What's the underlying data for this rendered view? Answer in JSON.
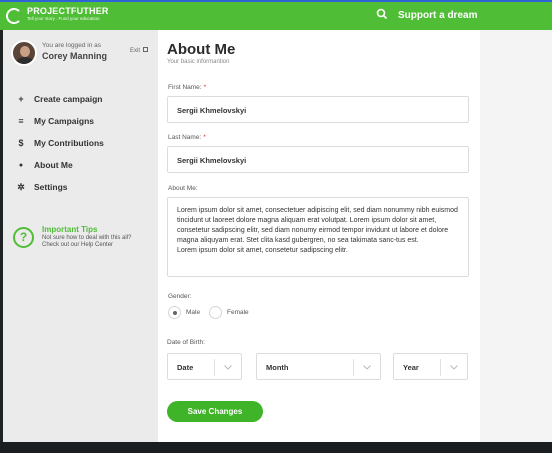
{
  "topbar": {
    "logo_title": "PROJECTFUTHER",
    "logo_tagline": "Tell your story . Fund your education",
    "search_icon": "search-icon",
    "cta_label": "Support a dream",
    "colors": {
      "bar": "#4fbe36",
      "accent_strip": "#2f64d8"
    }
  },
  "sidebar": {
    "user": {
      "logged_in_label": "You are logged in as",
      "name": "Corey Manning",
      "exit_label": "Exit",
      "exit_icon": "exit-icon"
    },
    "nav": [
      {
        "icon": "plus-icon",
        "glyph": "+",
        "label": "Create campaign"
      },
      {
        "icon": "list-icon",
        "glyph": "≡",
        "label": "My Campaigns"
      },
      {
        "icon": "dollar-icon",
        "glyph": "$",
        "label": "My Contributions"
      },
      {
        "icon": "user-icon",
        "glyph": "●",
        "label": "About Me"
      },
      {
        "icon": "gear-icon",
        "glyph": "✲",
        "label": "Settings"
      }
    ],
    "tips": {
      "icon": "question-icon",
      "glyph": "?",
      "title": "Important Tips",
      "line1": "Not sure how to deal with this all?",
      "line2": "Check out our Help Center"
    }
  },
  "main": {
    "title": "About Me",
    "subtitle": "Your basic informantion",
    "first_name": {
      "label": "First Name:",
      "required_mark": "*",
      "value": "Sergii Khmelovskyi"
    },
    "last_name": {
      "label": "Last Name:",
      "required_mark": "*",
      "value": "Sergii Khmelovskyi"
    },
    "about": {
      "label": "About Me:",
      "paragraph1": "Lorem ipsum dolor sit amet, consectetuer adipiscing elit, sed diam nonummy nibh euismod tincidunt ut laoreet dolore magna aliquam erat volutpat. Lorem ipsum dolor sit amet, consetetur sadipscing elitr, sed diam nonumy eirmod tempor invidunt ut labore et dolore magna aliquyam erat. Stet clita kasd gubergren, no sea takimata sanc-tus est.",
      "paragraph2": "Lorem ipsum dolor sit amet, consetetur sadipscing elitr."
    },
    "gender": {
      "label": "Gender:",
      "options": [
        "Male",
        "Female"
      ],
      "selected": "Male"
    },
    "dob": {
      "label": "Date of Birth:",
      "day": "Date",
      "month": "Month",
      "year": "Year",
      "chevron_icon": "chevron-down-icon"
    },
    "save_label": "Save Changes",
    "colors": {
      "button": "#3fb428",
      "required": "#e02424"
    }
  }
}
